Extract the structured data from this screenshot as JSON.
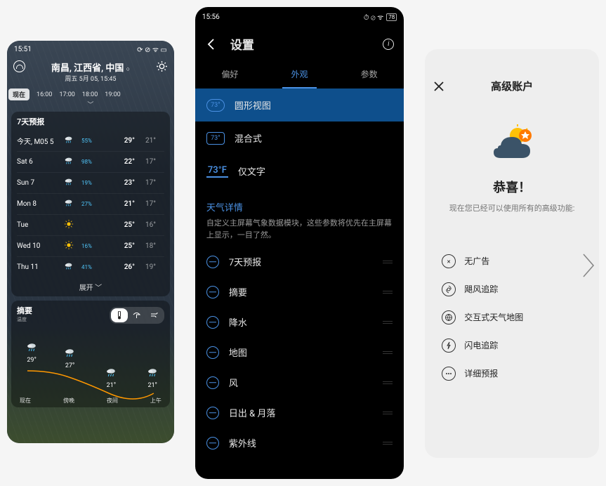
{
  "phone1": {
    "status_time": "15:51",
    "location": "南昌, 江西省, 中国",
    "date_line": "周五 5月 05, 15:45",
    "hourly": {
      "now": "现在",
      "times": [
        "16:00",
        "17:00",
        "18:00",
        "19:00"
      ]
    },
    "forecast_title": "7天预报",
    "forecast": [
      {
        "day": "今天, M05 5",
        "pct": "55%",
        "hi": "29°",
        "lo": "21°",
        "icon": "rain"
      },
      {
        "day": "Sat 6",
        "pct": "98%",
        "hi": "22°",
        "lo": "17°",
        "icon": "rain"
      },
      {
        "day": "Sun 7",
        "pct": "19%",
        "hi": "23°",
        "lo": "17°",
        "icon": "rain"
      },
      {
        "day": "Mon 8",
        "pct": "27%",
        "hi": "21°",
        "lo": "17°",
        "icon": "rain"
      },
      {
        "day": "Tue",
        "pct": "",
        "hi": "25°",
        "lo": "16°",
        "icon": "sun"
      },
      {
        "day": "Wed 10",
        "pct": "16%",
        "hi": "25°",
        "lo": "18°",
        "icon": "sun"
      },
      {
        "day": "Thu 11",
        "pct": "41%",
        "hi": "26°",
        "lo": "19°",
        "icon": "rain"
      }
    ],
    "expand": "展开",
    "summary_title": "摘要",
    "summary_sub": "温度",
    "chart_labels": [
      "现在",
      "傍晚",
      "夜间",
      "上午"
    ],
    "chart_points": [
      {
        "t": "29°",
        "i": "rain"
      },
      {
        "t": "27°",
        "i": "rain"
      },
      {
        "t": "21°",
        "i": "rain"
      },
      {
        "t": "21°",
        "i": "rain"
      }
    ]
  },
  "phone2": {
    "status_time": "15:56",
    "battery": "78",
    "title": "设置",
    "tabs": [
      "偏好",
      "外观",
      "参数"
    ],
    "active_tab": 1,
    "view_circle": "圆形视图",
    "view_mixed": "混合式",
    "view_text": "仅文字",
    "badge_temp": "73°",
    "badge_temp_f": "73°F",
    "section_title": "天气详情",
    "section_desc": "自定义主屏幕气象数据模块，这些参数将优先在主屏幕上显示，一目了然。",
    "details": [
      "7天预报",
      "摘要",
      "降水",
      "地图",
      "风",
      "日出 & 月落",
      "紫外线"
    ]
  },
  "phone3": {
    "title": "高级账户",
    "congrats": "恭喜！",
    "desc": "现在您已经可以使用所有的高级功能:",
    "features": [
      {
        "icon": "no-ad",
        "label": "无广告"
      },
      {
        "icon": "hurricane",
        "label": "飓风追踪"
      },
      {
        "icon": "globe",
        "label": "交互式天气地图"
      },
      {
        "icon": "bolt",
        "label": "闪电追踪"
      },
      {
        "icon": "dots",
        "label": "详细预报"
      }
    ]
  },
  "chart_data": {
    "type": "line",
    "categories": [
      "现在",
      "傍晚",
      "夜间",
      "上午"
    ],
    "values": [
      29,
      27,
      21,
      21
    ],
    "title": "温度",
    "ylabel": "°"
  }
}
